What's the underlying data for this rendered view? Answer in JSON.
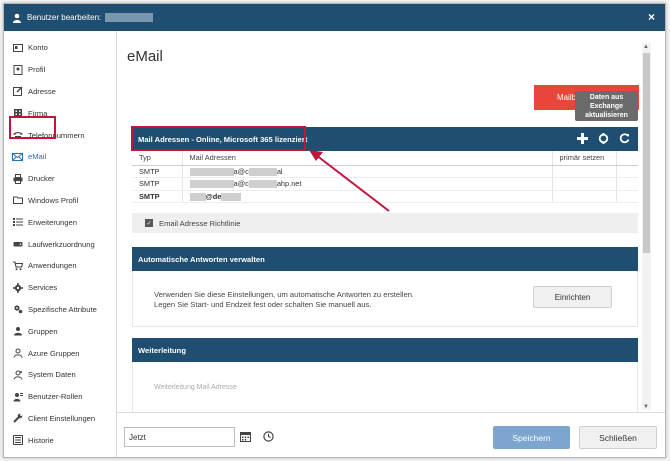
{
  "window": {
    "title": "Benutzer bearbeiten:",
    "close_label": "×"
  },
  "sidebar": {
    "items": [
      {
        "label": "Konto",
        "icon": "id-card-icon"
      },
      {
        "label": "Profil",
        "icon": "profile-icon"
      },
      {
        "label": "Adresse",
        "icon": "address-icon"
      },
      {
        "label": "Firma",
        "icon": "company-icon"
      },
      {
        "label": "Telefonnummern",
        "icon": "phone-icon"
      },
      {
        "label": "eMail",
        "icon": "envelope-icon"
      },
      {
        "label": "Drucker",
        "icon": "printer-icon"
      },
      {
        "label": "Windows Profil",
        "icon": "folder-icon"
      },
      {
        "label": "Erweiterungen",
        "icon": "list-icon"
      },
      {
        "label": "Laufwerkzuordnung",
        "icon": "drive-icon"
      },
      {
        "label": "Anwendungen",
        "icon": "cart-icon"
      },
      {
        "label": "Services",
        "icon": "gear-icon"
      },
      {
        "label": "Spezifische Attribute",
        "icon": "cog-icon"
      },
      {
        "label": "Gruppen",
        "icon": "group-icon"
      },
      {
        "label": "Azure Gruppen",
        "icon": "azure-group-icon"
      },
      {
        "label": "System Daten",
        "icon": "system-icon"
      },
      {
        "label": "Benutzer-Rollen",
        "icon": "roles-icon"
      },
      {
        "label": "Client Einstellungen",
        "icon": "wrench-icon"
      },
      {
        "label": "Historie",
        "icon": "history-icon"
      }
    ],
    "active_index": 5
  },
  "main": {
    "title": "eMail",
    "mailbox_button": "Mailb",
    "tooltip": "Daten aus Exchange aktualisieren",
    "mail_panel": {
      "title": "Mail Adressen - Online, Microsoft 365 lizenziert",
      "columns": [
        "Typ",
        "Mail Adressen",
        "primär setzen"
      ],
      "rows": [
        {
          "type": "SMTP",
          "address_tail": "a@c",
          "address_end": "al",
          "bold": false
        },
        {
          "type": "SMTP",
          "address_tail": "a@c",
          "address_end": "ahp.net",
          "bold": false
        },
        {
          "type": "SMTP",
          "address_tail": "@de",
          "address_end": "",
          "bold": true
        }
      ],
      "checkbox_label": "Email Adresse Richtlinie"
    },
    "auto_reply_panel": {
      "title": "Automatische Antworten verwalten",
      "text_line1": "Verwenden Sie diese Einstellungen, um automatische Antworten zu erstellen.",
      "text_line2": "Legen Sie Start- und Endzeit fest oder schalten Sie manuell aus.",
      "button": "Einrichten"
    },
    "forward_panel": {
      "title": "Weiterleitung",
      "field_label": "Weiterleitung Mail Adresse"
    }
  },
  "footer": {
    "date_value": "Jetzt",
    "save_label": "Speichern",
    "close_label": "Schließen"
  },
  "colors": {
    "header": "#1f4e70",
    "accent_red": "#e8453b",
    "highlight": "#c0163c",
    "save": "#7ca6cd"
  }
}
